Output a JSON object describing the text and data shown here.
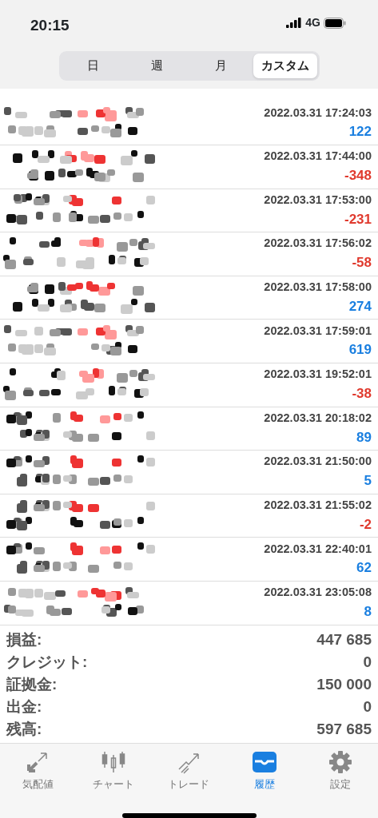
{
  "status_bar": {
    "time": "20:15",
    "network": "4G"
  },
  "periods": [
    {
      "label": "日",
      "selected": false
    },
    {
      "label": "週",
      "selected": false
    },
    {
      "label": "月",
      "selected": false
    },
    {
      "label": "カスタム",
      "selected": true
    }
  ],
  "deals": [
    {
      "time": "2022.03.31 17:24:03",
      "profit": "122",
      "kind": "gain"
    },
    {
      "time": "2022.03.31 17:44:00",
      "profit": "-348",
      "kind": "loss"
    },
    {
      "time": "2022.03.31 17:53:00",
      "profit": "-231",
      "kind": "loss"
    },
    {
      "time": "2022.03.31 17:56:02",
      "profit": "-58",
      "kind": "loss"
    },
    {
      "time": "2022.03.31 17:58:00",
      "profit": "274",
      "kind": "gain"
    },
    {
      "time": "2022.03.31 17:59:01",
      "profit": "619",
      "kind": "gain"
    },
    {
      "time": "2022.03.31 19:52:01",
      "profit": "-38",
      "kind": "loss"
    },
    {
      "time": "2022.03.31 20:18:02",
      "profit": "89",
      "kind": "gain"
    },
    {
      "time": "2022.03.31 21:50:00",
      "profit": "5",
      "kind": "gain"
    },
    {
      "time": "2022.03.31 21:55:02",
      "profit": "-2",
      "kind": "loss"
    },
    {
      "time": "2022.03.31 22:40:01",
      "profit": "62",
      "kind": "gain"
    },
    {
      "time": "2022.03.31 23:05:08",
      "profit": "8",
      "kind": "gain"
    }
  ],
  "summary": [
    {
      "label": "損益:",
      "value": "447 685"
    },
    {
      "label": "クレジット:",
      "value": "0"
    },
    {
      "label": "証拠金:",
      "value": "150 000"
    },
    {
      "label": "出金:",
      "value": "0"
    },
    {
      "label": "残高:",
      "value": "597 685"
    }
  ],
  "tab_bar": [
    {
      "label": "気配値",
      "kind": "quotes",
      "selected": false
    },
    {
      "label": "チャート",
      "kind": "chart",
      "selected": false
    },
    {
      "label": "トレード",
      "kind": "trade",
      "selected": false
    },
    {
      "label": "履歴",
      "kind": "history",
      "selected": true
    },
    {
      "label": "設定",
      "kind": "settings",
      "selected": false
    }
  ]
}
